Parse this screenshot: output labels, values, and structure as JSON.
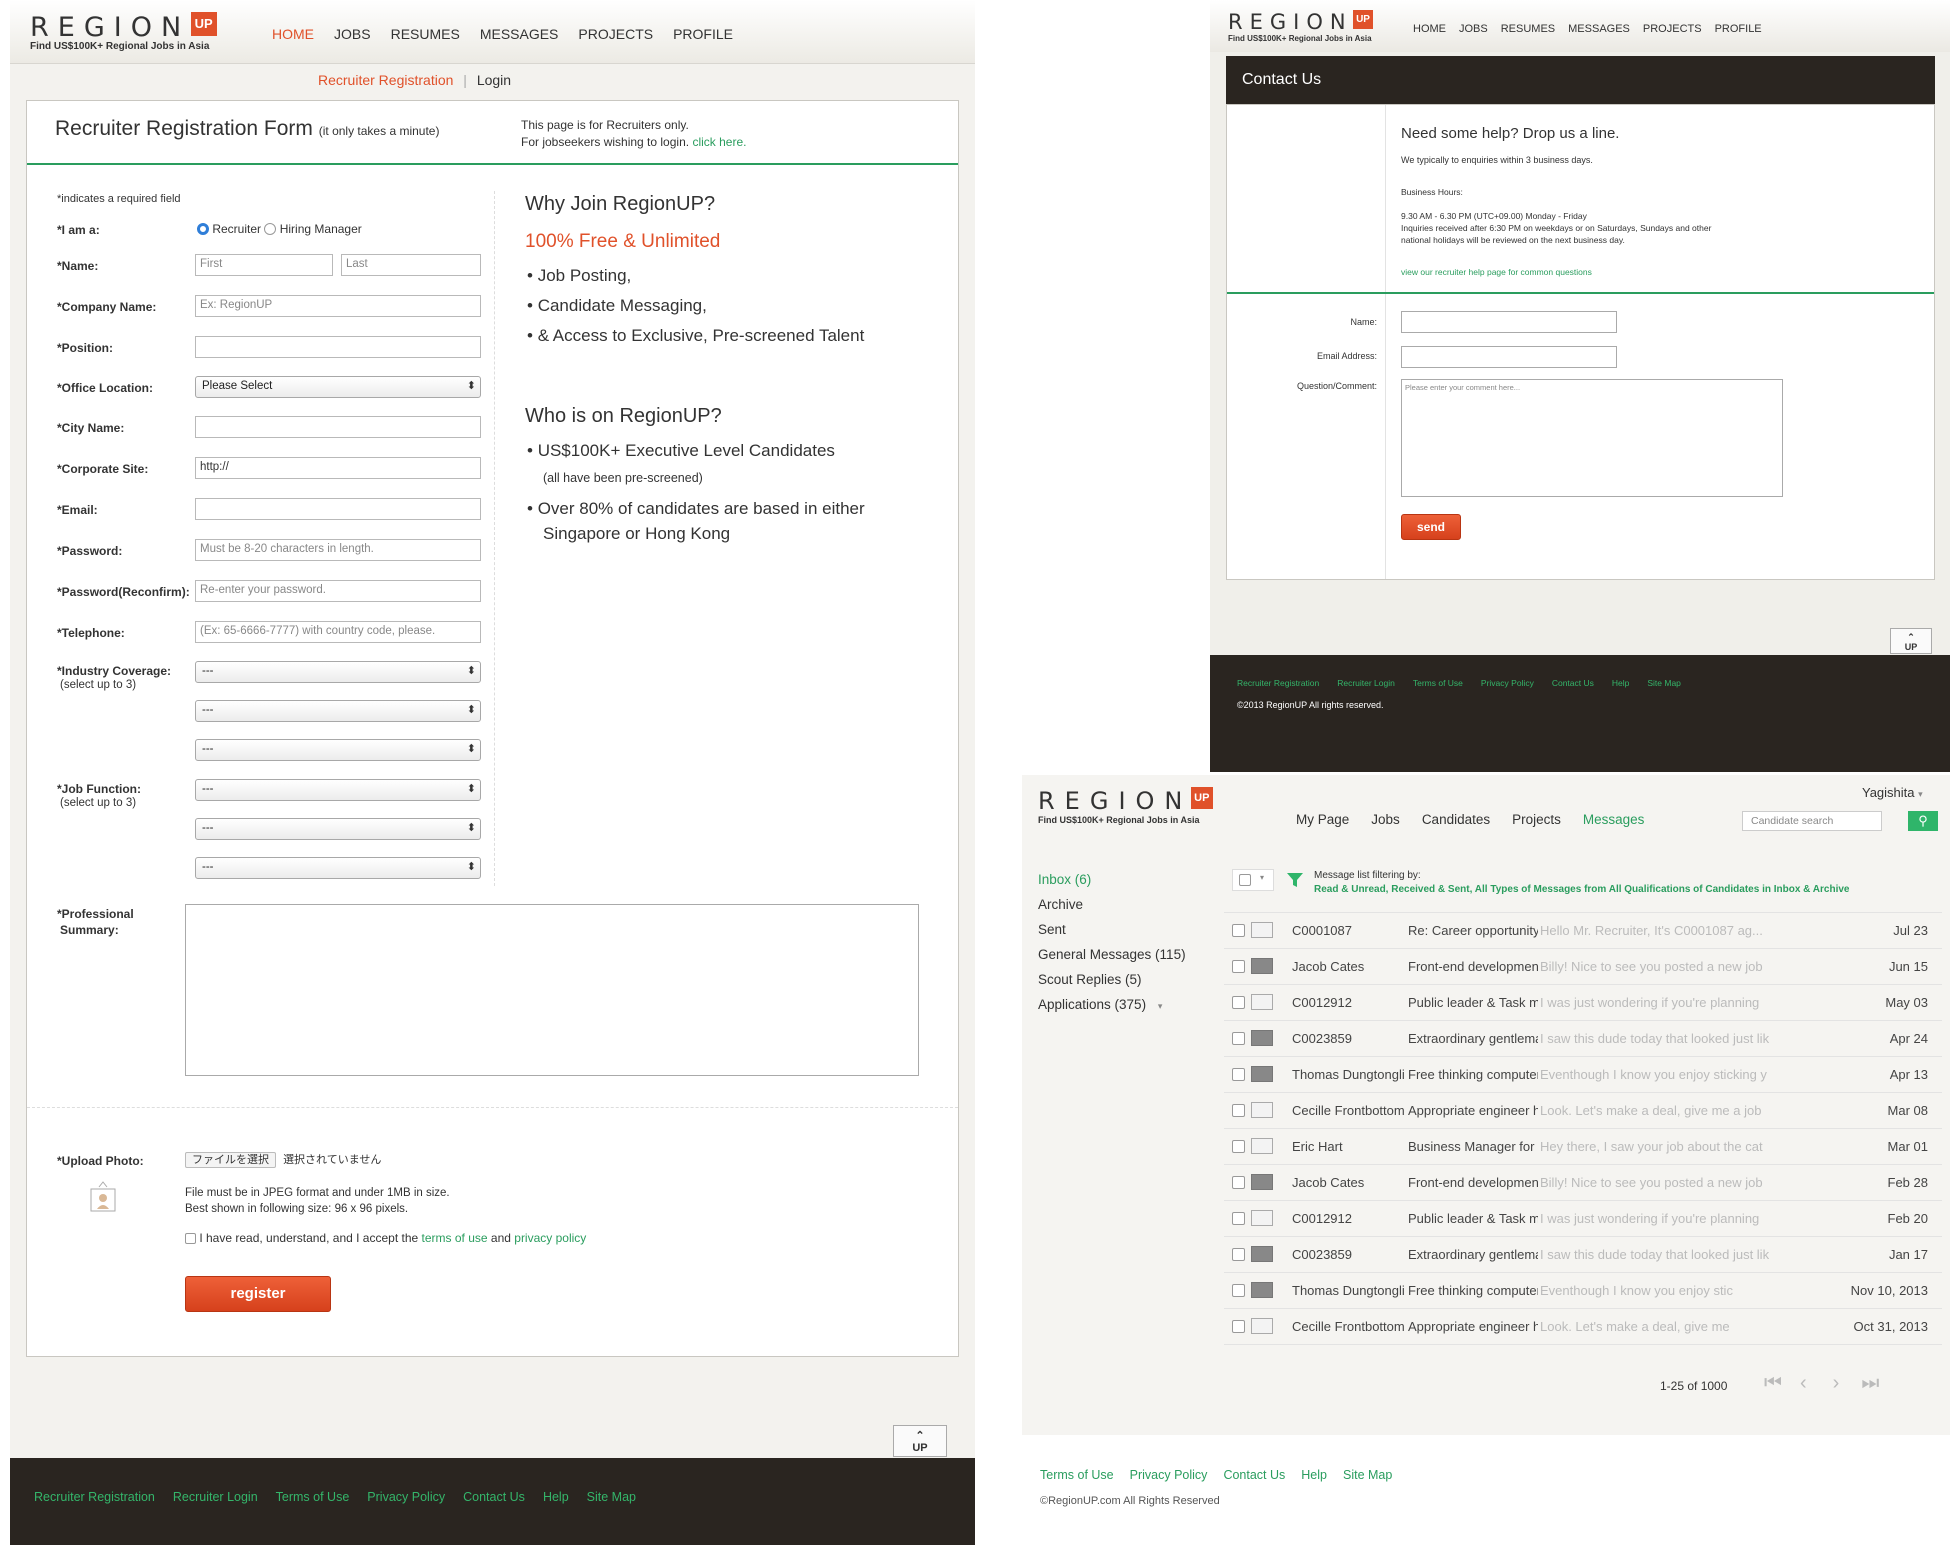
{
  "brand": {
    "word": "REGION",
    "up": "UP",
    "tagline": "Find US$100K+ Regional Jobs in Asia",
    "accent": "#e0512a",
    "green": "#2a9d5e"
  },
  "reg": {
    "nav": [
      "HOME",
      "JOBS",
      "RESUMES",
      "MESSAGES",
      "PROJECTS",
      "PROFILE"
    ],
    "subnav": {
      "register": "Recruiter Registration",
      "sep": "|",
      "login": "Login"
    },
    "title": "Recruiter Registration Form",
    "title_note": "(it only takes a minute)",
    "note1": "This page is for Recruiters only.",
    "note2": "For jobseekers wishing to login.",
    "note_link": "click here.",
    "required_note": "*indicates a required field",
    "labels": {
      "iam": "*I am a:",
      "name": "*Name:",
      "company": "*Company Name:",
      "position": "*Position:",
      "office": "*Office Location:",
      "city": "*City Name:",
      "site": "*Corporate Site:",
      "email": "*Email:",
      "password": "*Password:",
      "reconfirm": "*Password(Reconfirm):",
      "telephone": "*Telephone:",
      "industry": "*Industry Coverage:",
      "industry_sub": "(select up to 3)",
      "jobfn": "*Job Function:",
      "jobfn_sub": "(select up to 3)",
      "summary1": "*Professional",
      "summary2": "Summary:",
      "upload": "*Upload Photo:"
    },
    "radio_recruiter": "Recruiter",
    "radio_hiring": "Hiring Manager",
    "placeholders": {
      "first": "First",
      "last": "Last",
      "company": "Ex: RegionUP",
      "office": "Please Select",
      "site": "http://",
      "password": "Must be 8-20 characters in length.",
      "reconfirm": "Re-enter your password.",
      "telephone": "(Ex: 65-6666-7777) with country code, please.",
      "dash": "---"
    },
    "why_title": "Why Join RegionUP?",
    "why_highlight": "100% Free & Unlimited",
    "why_items": [
      "Job Posting,",
      "Candidate Messaging,",
      "& Access to Exclusive, Pre-screened Talent"
    ],
    "who_title": "Who is on RegionUP?",
    "who_item1": "US$100K+ Executive Level Candidates",
    "who_item1_sub": "(all have been pre-screened)",
    "who_item2a": "Over 80% of candidates are based in either",
    "who_item2b": "Singapore or Hong Kong",
    "file_button": "ファイルを選択",
    "file_none": "選択されていません",
    "file_note1": "File must be in JPEG format and under 1MB in size.",
    "file_note2": "Best shown in following size: 96 x 96 pixels.",
    "terms_pre": "I have read, understand, and I accept the",
    "terms_link": "terms of use",
    "terms_and": "and",
    "privacy_link": "privacy policy",
    "register_btn": "register",
    "up_btn": "UP",
    "footer": [
      "Recruiter Registration",
      "Recruiter Login",
      "Terms of Use",
      "Privacy Policy",
      "Contact Us",
      "Help",
      "Site Map"
    ]
  },
  "contact": {
    "nav": [
      "HOME",
      "JOBS",
      "RESUMES",
      "MESSAGES",
      "PROJECTS",
      "PROFILE"
    ],
    "title": "Contact Us",
    "headline": "Need some help? Drop us a line.",
    "reply": "We typically to enquiries within 3 business days.",
    "hours_label": "Business Hours:",
    "hours": "9.30 AM - 6.30 PM (UTC+09.00) Monday - Friday",
    "hours_note1": "Inquiries received after 6:30 PM on weekdays or on Saturdays, Sundays and other",
    "hours_note2": "national holidays will be reviewed on the next business day.",
    "help_link": "view our recruiter help page for common questions",
    "name_label": "Name:",
    "email_label": "Email Address:",
    "comment_label": "Question/Comment:",
    "comment_placeholder": "Please enter your comment here...",
    "send_btn": "send",
    "up_btn": "UP",
    "footer": [
      "Recruiter Registration",
      "Recruiter Login",
      "Terms of Use",
      "Privacy Policy",
      "Contact Us",
      "Help",
      "Site Map"
    ],
    "copyright": "©2013 RegionUP All rights reserved."
  },
  "inbox": {
    "user": "Yagishita",
    "nav": [
      "My Page",
      "Jobs",
      "Candidates",
      "Projects",
      "Messages"
    ],
    "search_placeholder": "Candidate search",
    "folders": [
      "Inbox (6)",
      "Archive",
      "Sent",
      "General Messages (115)",
      "Scout Replies (5)",
      "Applications (375)"
    ],
    "filter_label": "Message list filtering by:",
    "filter_value": "Read & Unread, Received & Sent, All Types of Messages from All Qualifications of Candidates in Inbox & Archive",
    "rows": [
      {
        "from": "C0001087",
        "subject": "Re: Career opportunity f...",
        "preview": "Hello Mr. Recruiter, It's C0001087 ag...",
        "date": "Jul 23",
        "dark": false
      },
      {
        "from": "Jacob Cates",
        "subject": "Front-end development ...",
        "preview": "Billy! Nice to see you posted a new job",
        "date": "Jun 15",
        "dark": true
      },
      {
        "from": "C0012912",
        "subject": "Public leader & Task ma...",
        "preview": "I was just wondering if you're planning",
        "date": "May 03",
        "dark": false
      },
      {
        "from": "C0023859",
        "subject": "Extraordinary gentleman...",
        "preview": "I saw this dude today that looked just lik",
        "date": "Apr 24",
        "dark": true
      },
      {
        "from": "Thomas Dungtonglitch",
        "subject": "Free thinking computer f...",
        "preview": "Eventhough I know you enjoy sticking y",
        "date": "Apr 13",
        "dark": true
      },
      {
        "from": "Cecille Frontbottom",
        "subject": "Appropriate engineer hel...",
        "preview": "Look. Let's make a deal, give me a job",
        "date": "Mar 08",
        "dark": false
      },
      {
        "from": "Eric Hart",
        "subject": "Business Manager for th...",
        "preview": "Hey there, I saw your job about the cat",
        "date": "Mar 01",
        "dark": false
      },
      {
        "from": "Jacob Cates",
        "subject": "Front-end development ...",
        "preview": "Billy! Nice to see you posted a new job",
        "date": "Feb 28",
        "dark": true
      },
      {
        "from": "C0012912",
        "subject": "Public leader & Task ma...",
        "preview": "I was just wondering if you're planning",
        "date": "Feb 20",
        "dark": false
      },
      {
        "from": "C0023859",
        "subject": "Extraordinary gentleman...",
        "preview": "I saw this dude today that looked just lik",
        "date": "Jan 17",
        "dark": true
      },
      {
        "from": "Thomas Dungtonglitch",
        "subject": "Free thinking computer f...",
        "preview": "Eventhough I know you enjoy stic",
        "date": "Nov 10, 2013",
        "dark": true
      },
      {
        "from": "Cecille Frontbottom",
        "subject": "Appropriate engineer hel...",
        "preview": "Look. Let's make a deal, give me",
        "date": "Oct 31, 2013",
        "dark": false
      }
    ],
    "pagination": "1-25 of 1000",
    "footer": [
      "Terms of Use",
      "Privacy Policy",
      "Contact Us",
      "Help",
      "Site Map"
    ],
    "copyright": "©RegionUP.com All Rights Reserved"
  }
}
